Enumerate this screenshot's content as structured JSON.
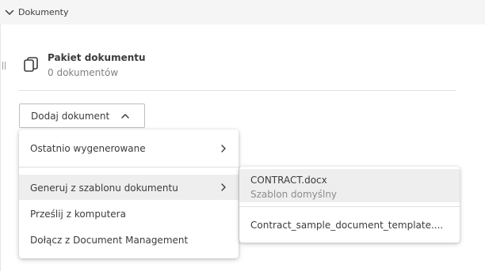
{
  "section": {
    "title": "Dokumenty",
    "toggle_icon": "chevron-down-icon"
  },
  "package": {
    "icon": "copy-documents-icon",
    "title": "Pakiet dokumentu",
    "count_text": "0 dokumentów"
  },
  "add_button": {
    "label": "Dodaj dokument",
    "icon": "chevron-up-icon"
  },
  "menu": {
    "items": [
      {
        "label": "Ostatnio wygenerowane",
        "has_submenu": true
      },
      {
        "label": "Generuj z szablonu dokumentu",
        "has_submenu": true,
        "highlighted": true
      },
      {
        "label": "Prześlij z komputera",
        "has_submenu": false
      },
      {
        "label": "Dołącz z Document Management",
        "has_submenu": false
      }
    ]
  },
  "submenu": {
    "items": [
      {
        "label": "CONTRACT.docx",
        "sublabel": "Szablon domyślny",
        "highlighted": true
      },
      {
        "label": "Contract_sample_document_template...."
      }
    ]
  },
  "colors": {
    "header_bg": "#f5f5f5",
    "highlight_bg": "#eeeeee",
    "text": "#3c3c3c",
    "muted_text": "#808080"
  }
}
